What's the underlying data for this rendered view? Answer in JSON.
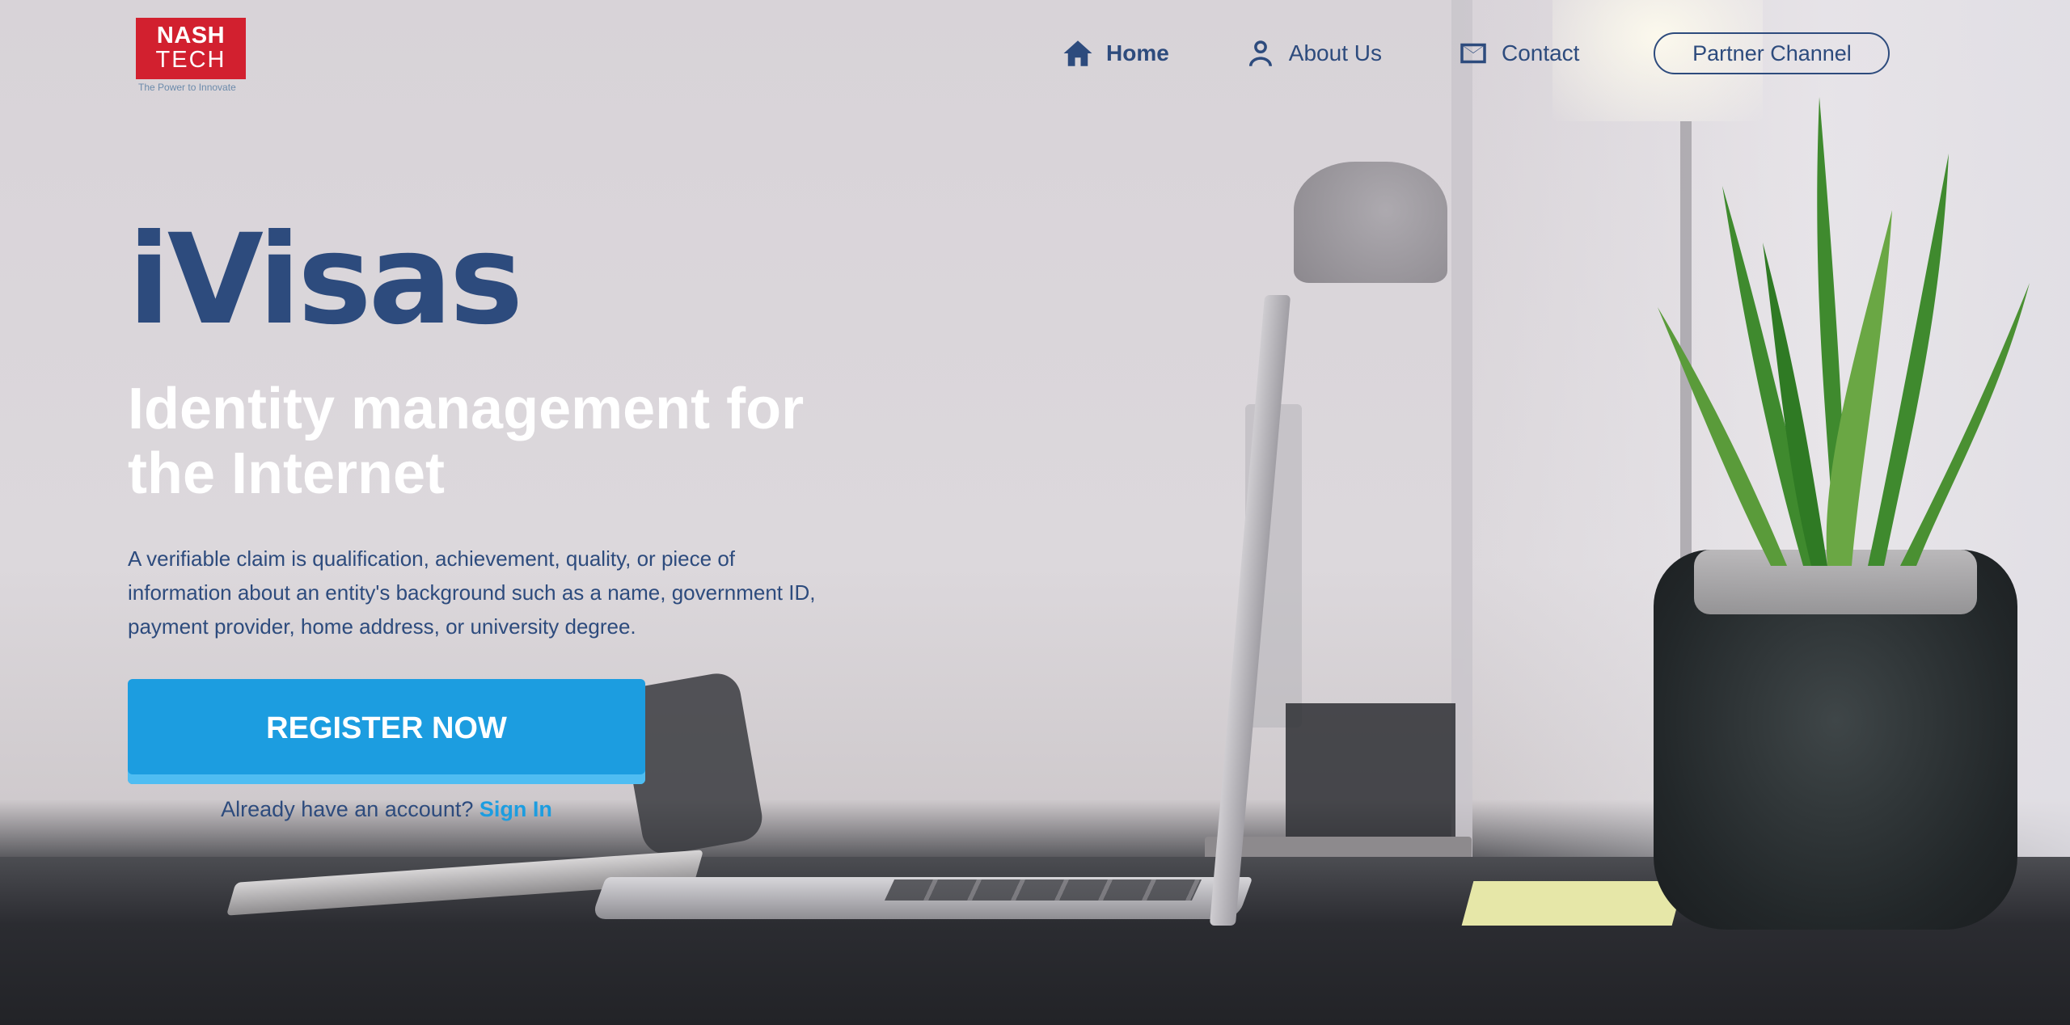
{
  "logo": {
    "line1": "NASH",
    "line2": "TECH",
    "tagline": "The Power to Innovate",
    "brand_color": "#d2202f"
  },
  "nav": {
    "items": [
      {
        "label": "Home",
        "icon": "home-icon",
        "active": true
      },
      {
        "label": "About Us",
        "icon": "user-icon",
        "active": false
      },
      {
        "label": "Contact",
        "icon": "mail-icon",
        "active": false
      }
    ],
    "partner_label": "Partner Channel"
  },
  "hero": {
    "brand": "iVisas",
    "headline": "Identity management for the Internet",
    "description": "A verifiable claim is qualification, achievement, quality, or piece of information about an entity's background such as a name, government ID, payment provider, home address, or university degree.",
    "register_label": "REGISTER NOW",
    "signin_prompt": "Already have an account?",
    "signin_label": "Sign In"
  },
  "colors": {
    "primary_text": "#2d4b7d",
    "accent": "#1c9de0",
    "headline": "#ffffff"
  }
}
